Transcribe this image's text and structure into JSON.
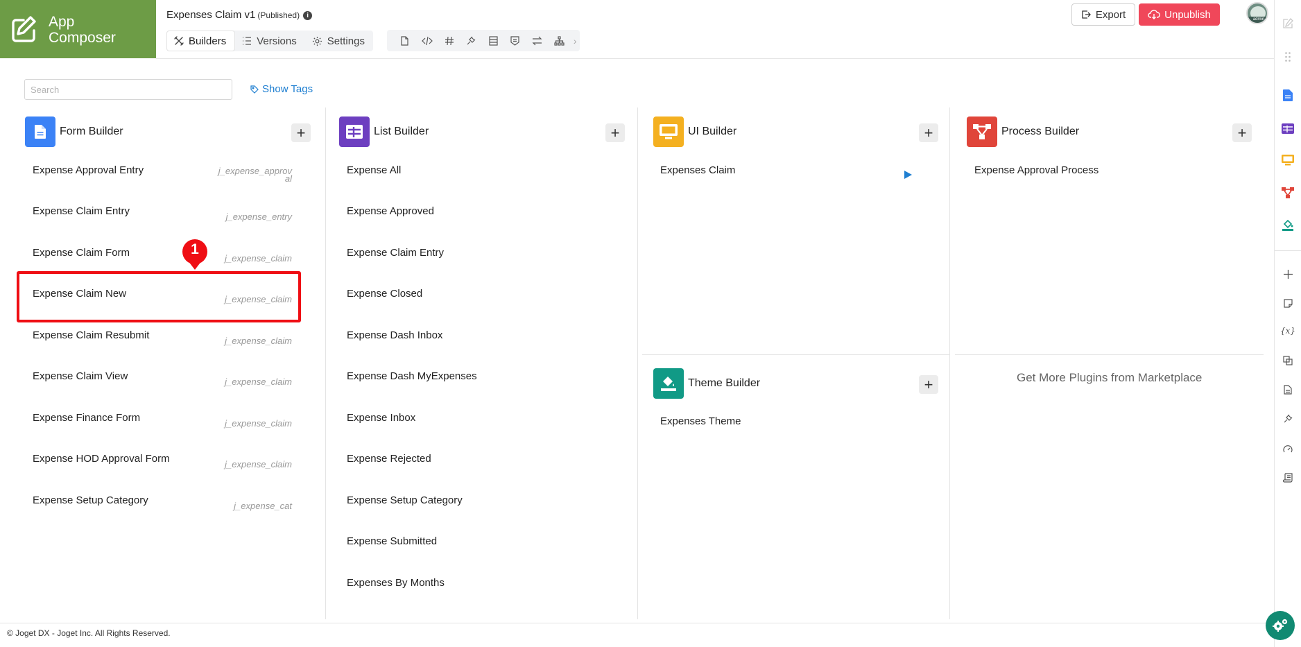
{
  "header": {
    "logo_text_line1": "App",
    "logo_text_line2": "Composer",
    "app_name": "Expenses Claim v1",
    "app_status": "(Published)",
    "info_icon": "i",
    "tabs": [
      {
        "label": "Builders",
        "icon": "tools-icon",
        "active": true
      },
      {
        "label": "Versions",
        "icon": "list-icon",
        "active": false
      },
      {
        "label": "Settings",
        "icon": "gear-icon",
        "active": false
      }
    ],
    "toolbar_icons": [
      "file-icon",
      "code-icon",
      "hash-icon",
      "plugin-icon",
      "table-icon",
      "badge-icon",
      "swap-icon",
      "sitemap-icon"
    ],
    "export_label": "Export",
    "unpublish_label": "Unpublish",
    "avatar_label": "admin"
  },
  "search": {
    "placeholder": "Search",
    "value": ""
  },
  "show_tags_label": "Show Tags",
  "builders": {
    "form": {
      "title": "Form Builder",
      "color": "#3b82f6",
      "items": [
        {
          "label": "Expense Approval Entry",
          "tag_line1": "j_expense_approv",
          "tag_line2": "al"
        },
        {
          "label": "Expense Claim Entry",
          "tag_line1": "j_expense_entry",
          "tag_line2": ""
        },
        {
          "label": "Expense Claim Form",
          "tag_line1": "j_expense_claim",
          "tag_line2": ""
        },
        {
          "label": "Expense Claim New",
          "tag_line1": "j_expense_claim",
          "tag_line2": ""
        },
        {
          "label": "Expense Claim Resubmit",
          "tag_line1": "j_expense_claim",
          "tag_line2": ""
        },
        {
          "label": "Expense Claim View",
          "tag_line1": "j_expense_claim",
          "tag_line2": ""
        },
        {
          "label": "Expense Finance Form",
          "tag_line1": "j_expense_claim",
          "tag_line2": ""
        },
        {
          "label": "Expense HOD Approval Form",
          "tag_line1": "j_expense_claim",
          "tag_line2": ""
        },
        {
          "label": "Expense Setup Category",
          "tag_line1": "j_expense_cat",
          "tag_line2": ""
        }
      ]
    },
    "list": {
      "title": "List Builder",
      "color": "#6d3fc0",
      "items": [
        "Expense All",
        "Expense Approved",
        "Expense Claim Entry",
        "Expense Closed",
        "Expense Dash Inbox",
        "Expense Dash MyExpenses",
        "Expense Inbox",
        "Expense Rejected",
        "Expense Setup Category",
        "Expense Submitted",
        "Expenses By Months"
      ]
    },
    "ui": {
      "title": "UI Builder",
      "color": "#f4b020",
      "items": [
        "Expenses Claim"
      ]
    },
    "process": {
      "title": "Process Builder",
      "color": "#e0453a",
      "items": [
        "Expense Approval Process"
      ]
    },
    "theme": {
      "title": "Theme Builder",
      "color": "#119a86",
      "items": [
        "Expenses Theme"
      ]
    }
  },
  "marketplace_label": "Get More Plugins from Marketplace",
  "callout_number": "1",
  "highlight_color": "#ef0e14",
  "footer_text": "© Joget DX - Joget Inc. All Rights Reserved.",
  "right_sidebar_icons": [
    "edit-icon",
    "drag-handle-icon",
    "form-icon",
    "list-icon",
    "ui-icon",
    "process-icon",
    "theme-icon",
    "plus-icon",
    "note-icon",
    "variable-icon",
    "resources-icon",
    "document-icon",
    "plugin-icon",
    "performance-icon",
    "log-icon"
  ]
}
